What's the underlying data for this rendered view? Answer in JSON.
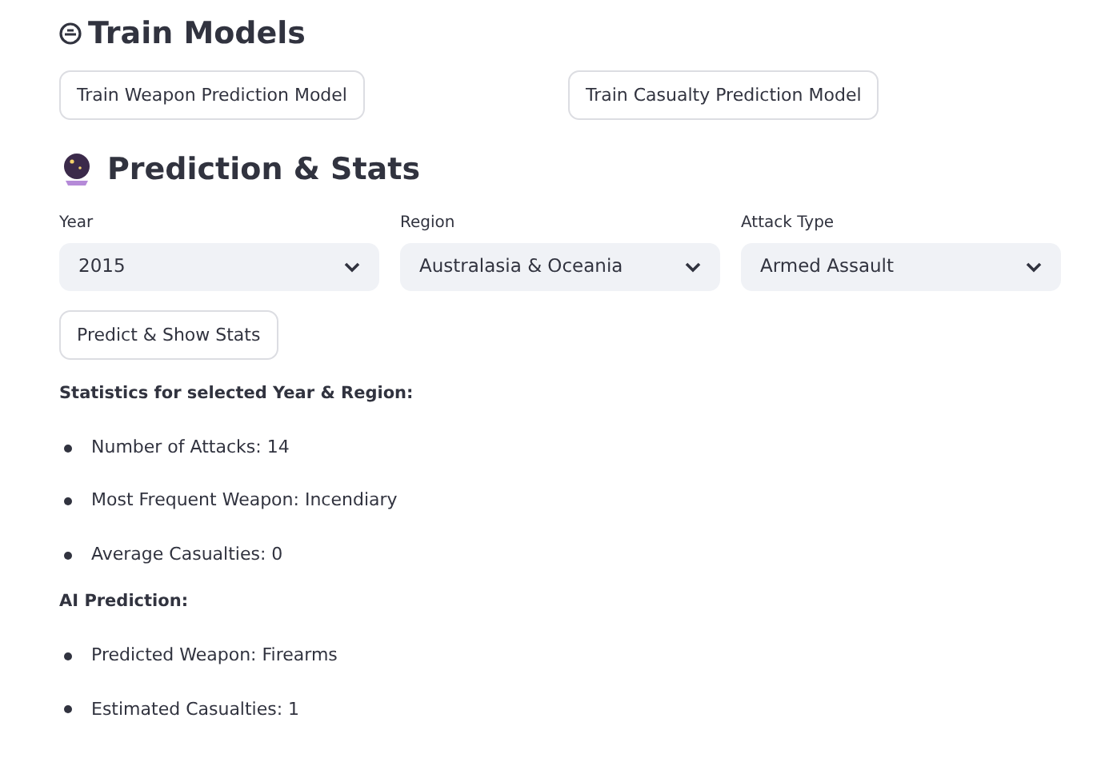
{
  "train_section": {
    "title": "Train Models",
    "buttons": [
      "Train Weapon Prediction Model",
      "Train Casualty Prediction Model"
    ]
  },
  "prediction_section": {
    "title": "Prediction & Stats",
    "selects": [
      {
        "label": "Year",
        "value": "2015"
      },
      {
        "label": "Region",
        "value": "Australasia & Oceania"
      },
      {
        "label": "Attack Type",
        "value": "Armed Assault"
      }
    ],
    "button": "Predict & Show Stats",
    "groups": [
      {
        "heading": "Statistics for selected Year & Region:",
        "items": [
          "Number of Attacks: 14",
          "Most Frequent Weapon: Incendiary",
          "Average Casualties: 0"
        ]
      },
      {
        "heading": "AI Prediction:",
        "items": [
          "Predicted Weapon: Firearms",
          "Estimated Casualties: 1"
        ]
      }
    ]
  }
}
